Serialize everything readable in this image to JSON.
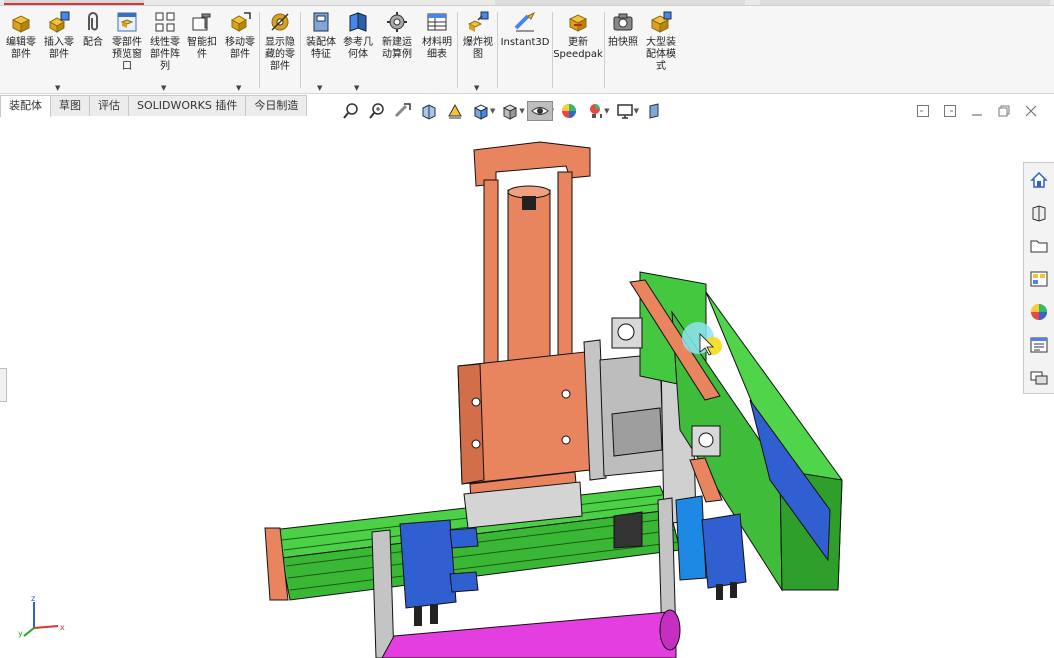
{
  "ribbon": {
    "buttons": [
      {
        "label": "编辑零\n部件"
      },
      {
        "label": "插入零\n部件"
      },
      {
        "label": "配合"
      },
      {
        "label": "零部件\n预览窗\n口"
      },
      {
        "label": "线性零\n部件阵\n列"
      },
      {
        "label": "智能扣\n件"
      },
      {
        "label": "移动零\n部件"
      },
      {
        "label": "显示隐\n藏的零\n部件"
      },
      {
        "label": "装配体\n特征"
      },
      {
        "label": "参考几\n何体"
      },
      {
        "label": "新建运\n动算例"
      },
      {
        "label": "材料明\n细表"
      },
      {
        "label": "爆炸视\n图"
      },
      {
        "label": "Instant3D"
      },
      {
        "label": "更新\nSpeedpak"
      },
      {
        "label": "拍快照"
      },
      {
        "label": "大型装\n配体模\n式"
      }
    ]
  },
  "tabs": [
    {
      "label": "装配体"
    },
    {
      "label": "草图"
    },
    {
      "label": "评估"
    },
    {
      "label": "SOLIDWORKS 插件"
    },
    {
      "label": "今日制造"
    }
  ],
  "triad": {
    "x": "x",
    "y": "y",
    "z": "z"
  },
  "colors": {
    "orange": "#e8845e",
    "green": "#3ec13a",
    "blue": "#2f5fd0",
    "magenta": "#e53ee0",
    "gray": "#bdbdbd"
  }
}
